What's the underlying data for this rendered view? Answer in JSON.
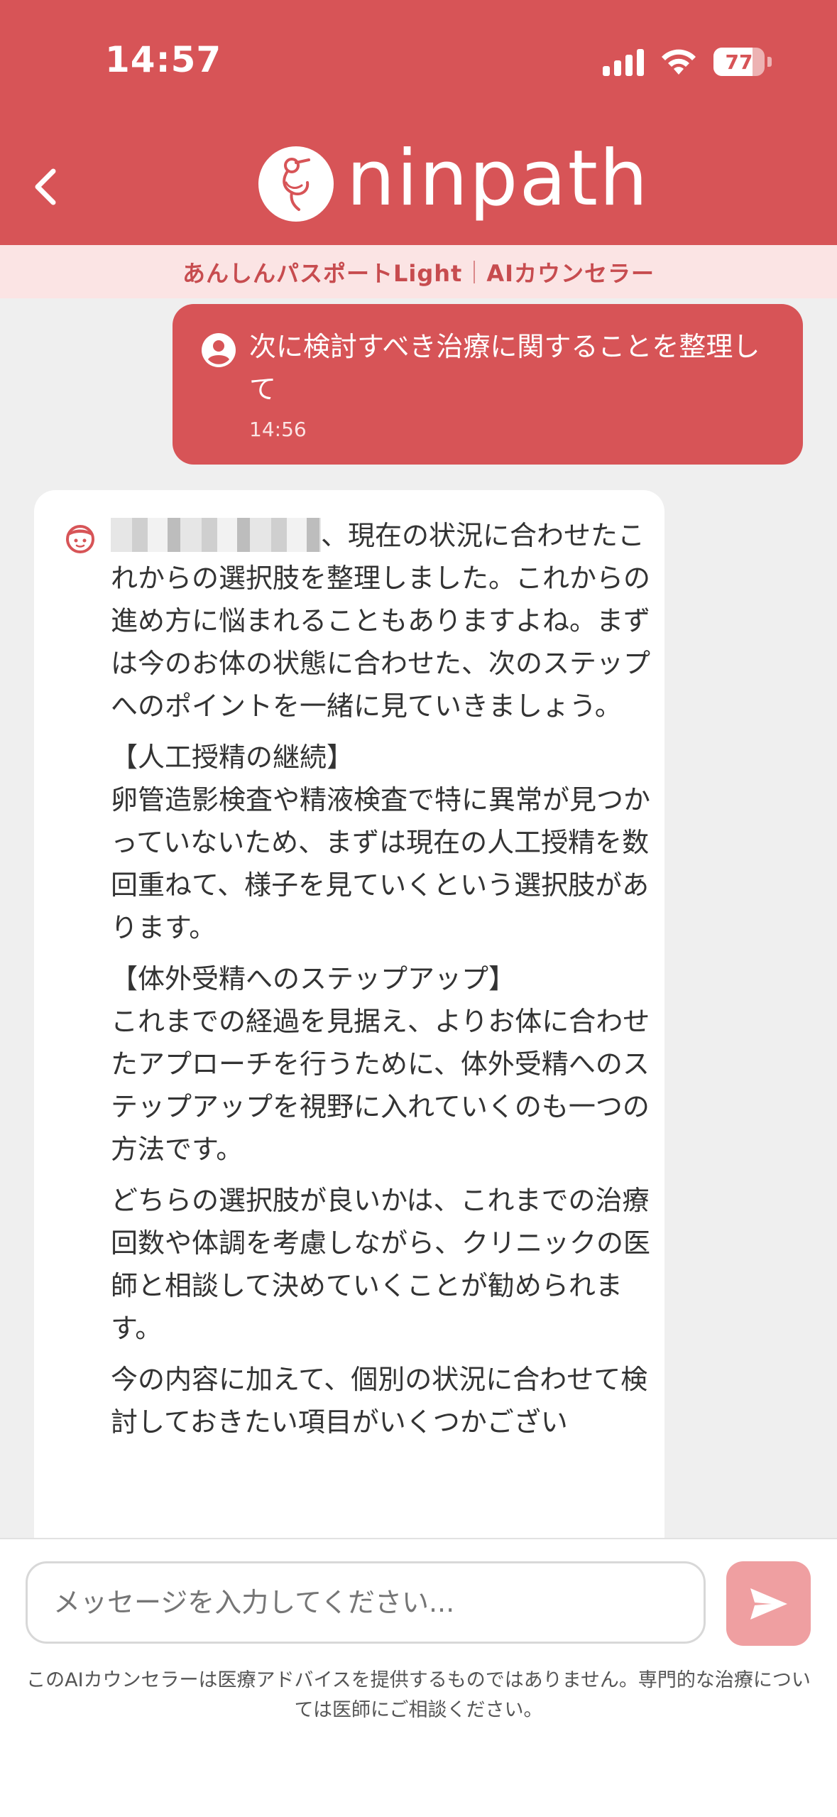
{
  "status_bar": {
    "time": "14:57",
    "battery": "77"
  },
  "header": {
    "logo_text": "ninpath"
  },
  "subheader": {
    "plan": "あんしんパスポートLight",
    "service": "AIカウンセラー"
  },
  "user_message": {
    "text": "次に検討すべき治療に関することを整理して",
    "time": "14:56"
  },
  "ai_message": {
    "intro": "、現在の状況に合わせたこれからの選択肢を整理しました。これからの進め方に悩まれることもありますよね。まずは今のお体の状態に合わせた、次のステップへのポイントを一緒に見ていきましょう。",
    "section1_title": "【人工授精の継続】",
    "section1_body": "卵管造影検査や精液検査で特に異常が見つかっていないため、まずは現在の人工授精を数回重ねて、様子を見ていくという選択肢があります。",
    "section2_title": "【体外受精へのステップアップ】",
    "section2_body": "これまでの経過を見据え、よりお体に合わせたアプローチを行うために、体外受精へのステップアップを視野に入れていくのも一つの方法です。",
    "para3": "どちらの選択肢が良いかは、これまでの治療回数や体調を考慮しながら、クリニックの医師と相談して決めていくことが勧められます。",
    "para4": "今の内容に加えて、個別の状況に合わせて検討しておきたい項目がいくつかござい"
  },
  "composer": {
    "placeholder": "メッセージを入力してください...",
    "disclaimer": "このAIカウンセラーは医療アドバイスを提供するものではありません。専門的な治療については医師にご相談ください。"
  },
  "colors": {
    "brand": "#d75457",
    "subbar_bg": "#fbe4e4",
    "send_disabled": "#ef9fa1"
  }
}
